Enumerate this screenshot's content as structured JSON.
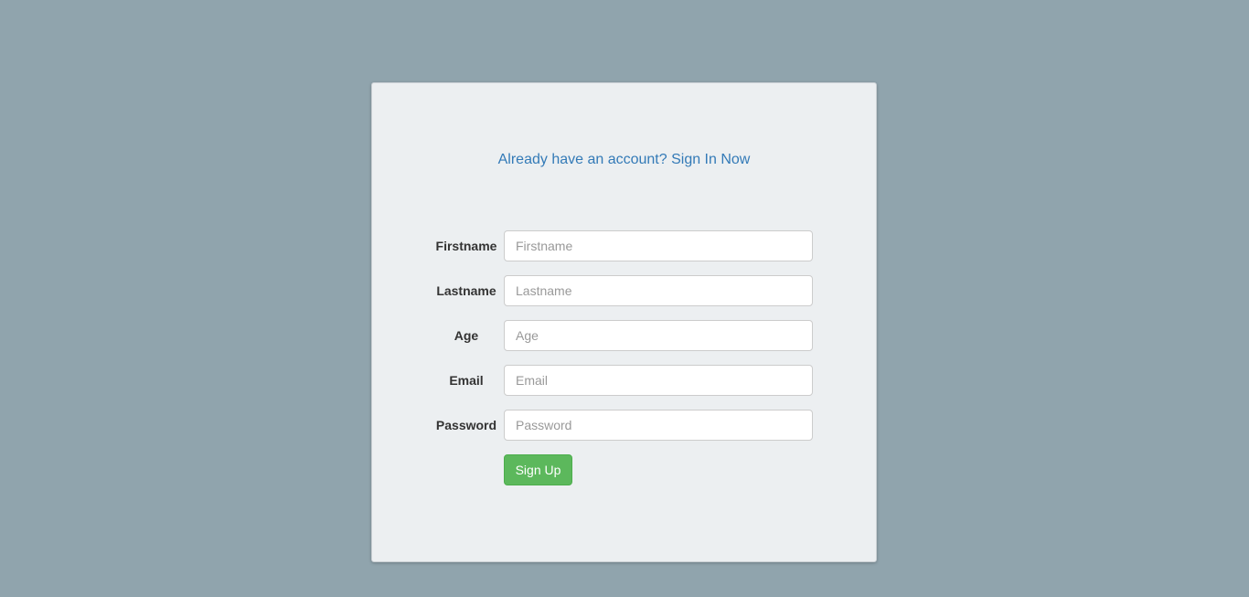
{
  "signin_link": "Already have an account? Sign In Now",
  "form": {
    "fields": [
      {
        "label": "Firstname",
        "placeholder": "Firstname",
        "value": ""
      },
      {
        "label": "Lastname",
        "placeholder": "Lastname",
        "value": ""
      },
      {
        "label": "Age",
        "placeholder": "Age",
        "value": ""
      },
      {
        "label": "Email",
        "placeholder": "Email",
        "value": ""
      },
      {
        "label": "Password",
        "placeholder": "Password",
        "value": ""
      }
    ],
    "submit_label": "Sign Up"
  },
  "colors": {
    "background": "#90a4ad",
    "card": "#eceff1",
    "link": "#337ab7",
    "primary_button": "#5cb85c"
  }
}
